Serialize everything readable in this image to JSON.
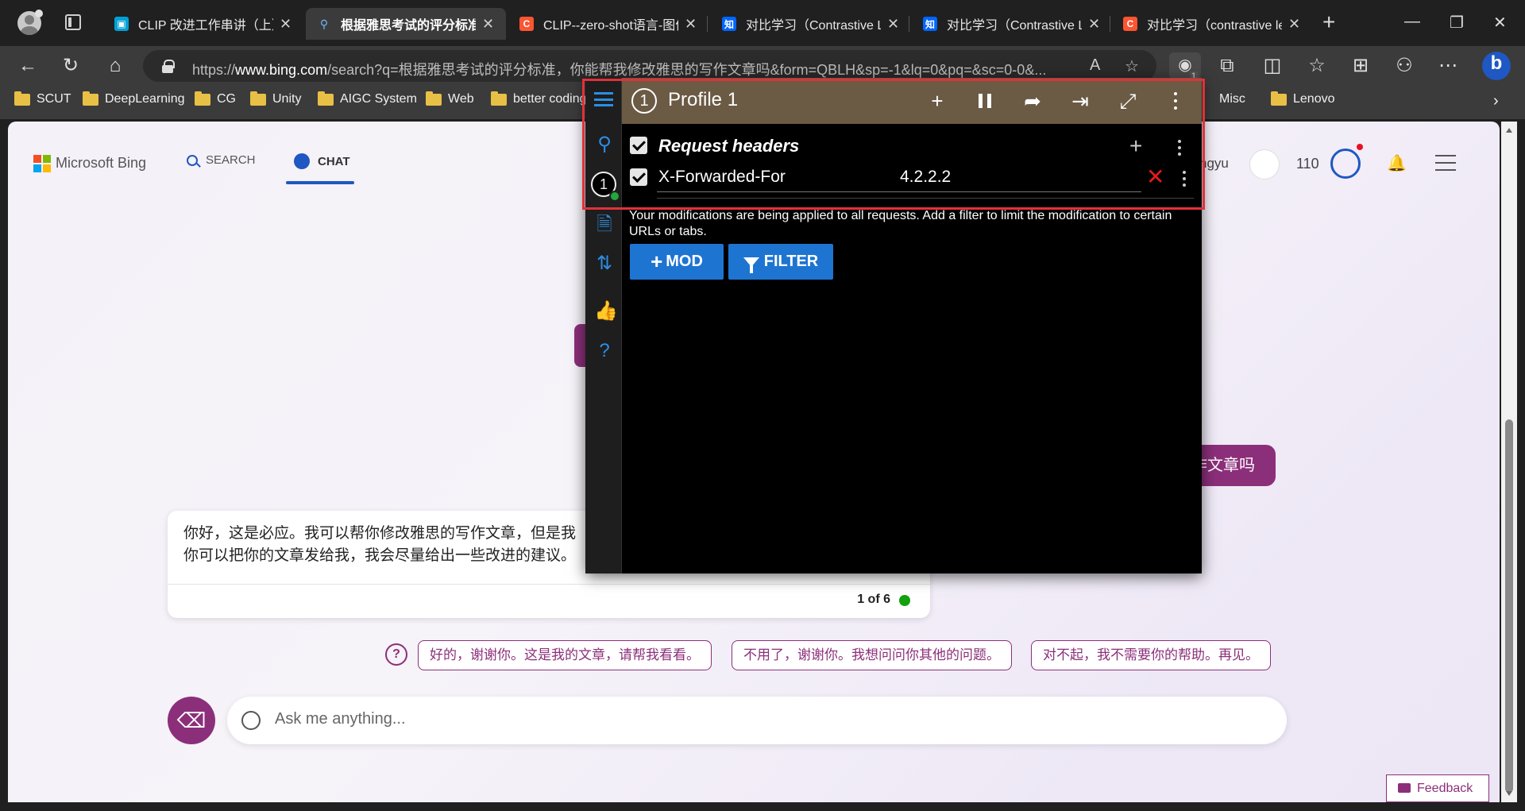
{
  "tabs": [
    {
      "title": "CLIP 改进工作串讲（上）",
      "favicon_color": "#00a1d6",
      "favicon_glyph": "tv-icon"
    },
    {
      "title": "根据雅思考试的评分标准",
      "favicon_color": "#3b3b3b",
      "favicon_glyph": "search-icon",
      "active": true
    },
    {
      "title": "CLIP--zero-shot语言-图像",
      "favicon_color": "#fc5531",
      "favicon_glyph": "C"
    },
    {
      "title": "对比学习（Contrastive L",
      "favicon_color": "#0066ff",
      "favicon_glyph": "知"
    },
    {
      "title": "对比学习（Contrastive L",
      "favicon_color": "#0066ff",
      "favicon_glyph": "知"
    },
    {
      "title": "对比学习（contrastive le",
      "favicon_color": "#fc5531",
      "favicon_glyph": "C"
    }
  ],
  "address_bar": {
    "url_prefix": "https://",
    "url_host": "www.bing.com",
    "url_rest": "/search?q=根据雅思考试的评分标准，你能帮我修改雅思的写作文章吗&form=QBLH&sp=-1&lq=0&pq=&sc=0-0&..."
  },
  "extension_badge": "1",
  "bookmarks": [
    "SCUT",
    "DeepLearning",
    "CG",
    "Unity",
    "AIGC System",
    "Web",
    "better coding",
    "Misc",
    "Lenovo"
  ],
  "bing": {
    "brand": "Microsoft Bing",
    "nav_search": "SEARCH",
    "nav_chat": "CHAT",
    "user_name_partial": "ngyu",
    "points": "110",
    "user_message_partial": "作文章吗",
    "bot_message_line1": "你好，这是必应。我可以帮你修改雅思的写作文章，但是我",
    "bot_message_line2": "你可以把你的文章发给我，我会尽量给出一些改进的建议。",
    "turn_counter": "1 of 6",
    "suggestions": [
      "好的，谢谢你。这是我的文章，请帮我看看。",
      "不用了，谢谢你。我想问问你其他的问题。",
      "对不起，我不需要你的帮助。再见。"
    ],
    "ask_placeholder": "Ask me anything...",
    "feedback": "Feedback"
  },
  "modheader": {
    "profile_number": "1",
    "profile_name": "Profile 1",
    "section_title": "Request headers",
    "header_name": "X-Forwarded-For",
    "header_value": "4.2.2.2",
    "info_text": "Your modifications are being applied to all requests. Add a filter to limit the modification to certain URLs or tabs.",
    "btn_mod": "MOD",
    "btn_filter": "FILTER",
    "header_color": "#6b5a44",
    "accent": "#1e74d1"
  }
}
